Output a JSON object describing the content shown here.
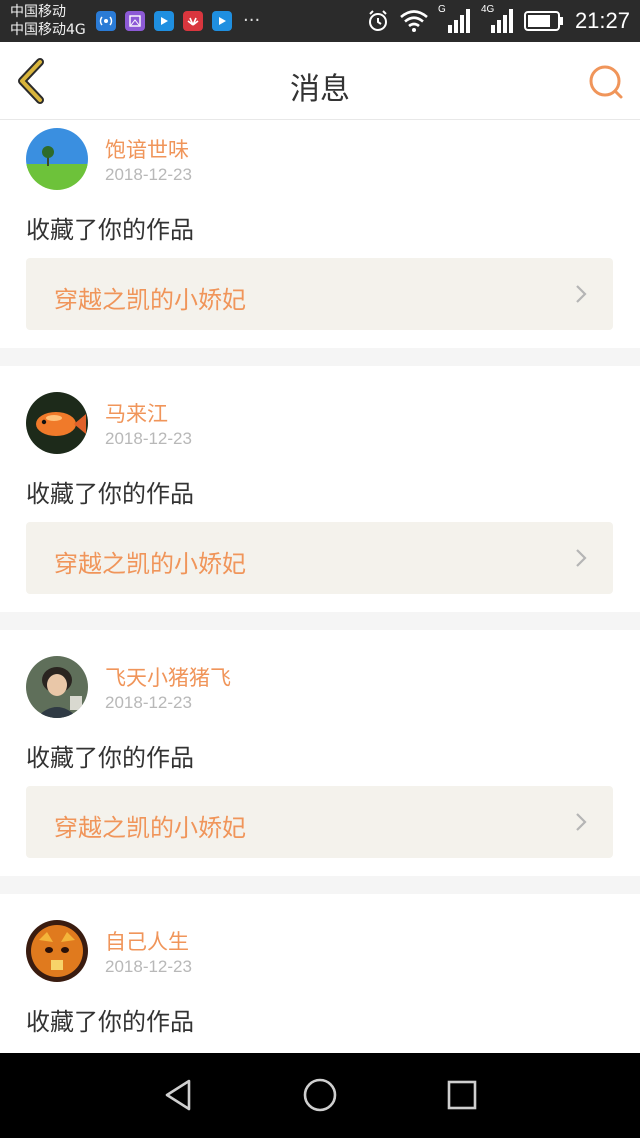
{
  "status_bar": {
    "carrier_1": "中国移动",
    "carrier_2": "中国移动4G",
    "signal_label_g": "G",
    "signal_label_4g": "4G",
    "time": "21:27",
    "more": "···"
  },
  "header": {
    "title": "消息"
  },
  "messages": [
    {
      "user": "饱谙世味",
      "date": "2018-12-23",
      "action": "收藏了你的作品",
      "work": "穿越之凯的小娇妃"
    },
    {
      "user": "马来江",
      "date": "2018-12-23",
      "action": "收藏了你的作品",
      "work": "穿越之凯的小娇妃"
    },
    {
      "user": "飞天小猪猪飞",
      "date": "2018-12-23",
      "action": "收藏了你的作品",
      "work": "穿越之凯的小娇妃"
    },
    {
      "user": "自己人生",
      "date": "2018-12-23",
      "action": "收藏了你的作品",
      "work": ""
    }
  ],
  "colors": {
    "accent": "#f0955a",
    "header_back": "#d9b53c",
    "link_bg": "#f4f2ec"
  },
  "icons": {
    "back": "chevron-left-icon",
    "search": "search-icon",
    "item_arrow": "chevron-right-icon",
    "nav_back": "triangle-back-icon",
    "nav_home": "circle-home-icon",
    "nav_recent": "square-recent-icon"
  }
}
